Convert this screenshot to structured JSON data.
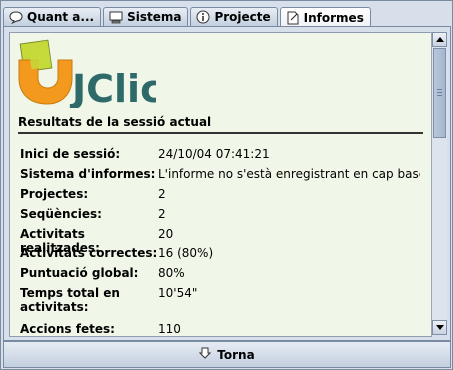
{
  "tabs": [
    {
      "label": "Quant a...",
      "icon": "speech-bubble-icon"
    },
    {
      "label": "Sistema",
      "icon": "monitor-icon"
    },
    {
      "label": "Projecte",
      "icon": "info-icon"
    },
    {
      "label": "Informes",
      "icon": "document-icon",
      "active": true
    }
  ],
  "logo": {
    "text": "JClic"
  },
  "report": {
    "heading": "Resultats de la sessió actual",
    "rows": [
      {
        "key": "Inici de sessió:",
        "value": "24/10/04 07:41:21"
      },
      {
        "key": "Sistema d'informes:",
        "value": "L'informe no s'està enregistrant en cap base de"
      },
      {
        "key": "Projectes:",
        "value": "2"
      },
      {
        "key": "Seqüències:",
        "value": "2"
      },
      {
        "key": "Activitats realitzades:",
        "value": "20"
      },
      {
        "key": "Activitats correctes:",
        "value": "16 (80%)"
      },
      {
        "key": "Puntuació global:",
        "value": "80%"
      },
      {
        "key": "Temps total en activitats:",
        "value": "10'54\""
      },
      {
        "key": "Accions fetes:",
        "value": "110"
      }
    ]
  },
  "footer": {
    "button_label": "Torna",
    "icon": "back-arrow-icon"
  },
  "colors": {
    "content_bg": "#f0f7e8",
    "chrome": "#d6dfea",
    "logo_orange": "#f39a1e",
    "logo_green": "#c6d93a",
    "logo_text": "#2f6a6a"
  }
}
